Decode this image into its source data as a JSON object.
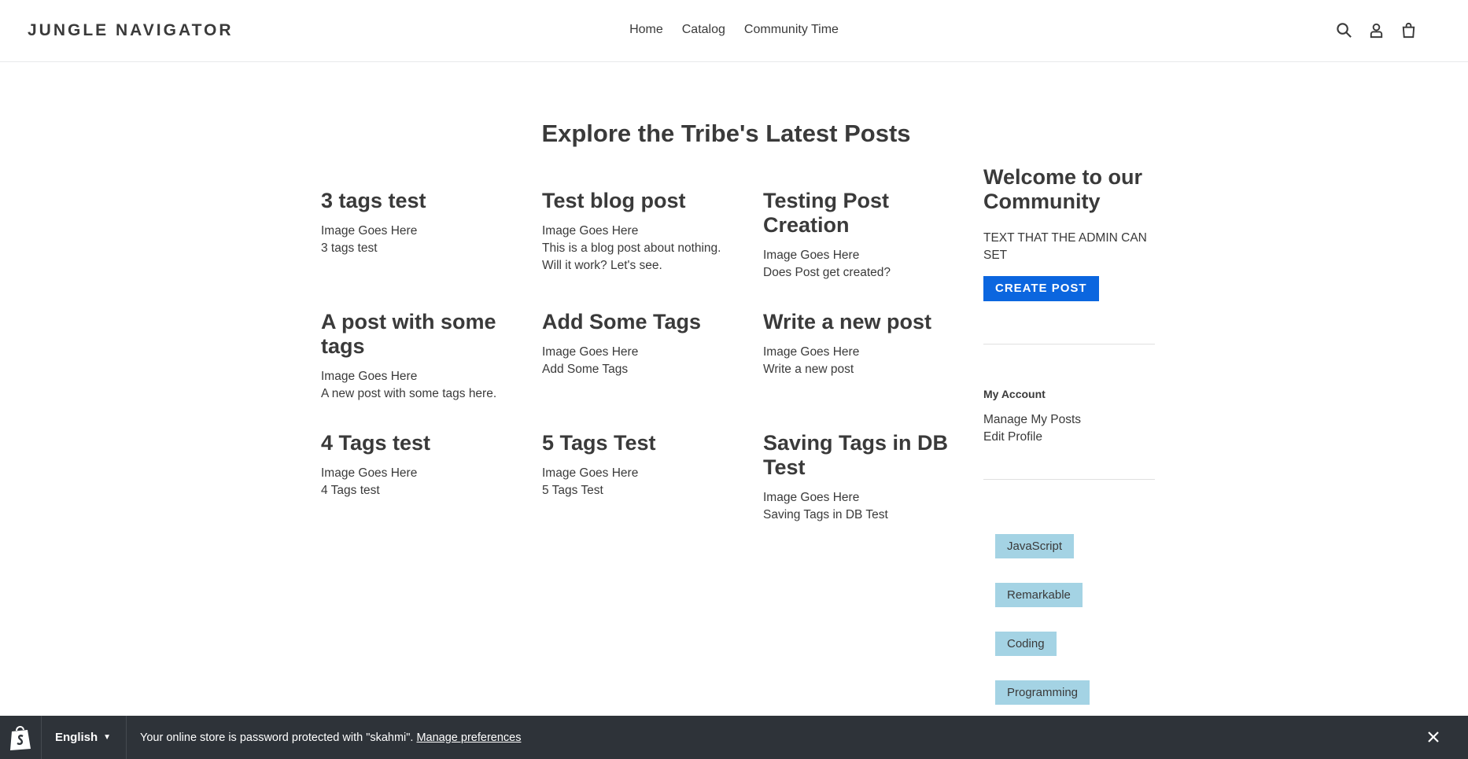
{
  "header": {
    "logo": "JUNGLE NAVIGATOR",
    "nav": [
      "Home",
      "Catalog",
      "Community Time"
    ]
  },
  "page_title": "Explore the Tribe's Latest Posts",
  "posts": [
    {
      "title": "3 tags test",
      "image": "Image Goes Here",
      "excerpt": "3 tags test"
    },
    {
      "title": "Test blog post",
      "image": "Image Goes Here",
      "excerpt": "This is a blog post about nothing. Will it work? Let's see."
    },
    {
      "title": "Testing Post Creation",
      "image": "Image Goes Here",
      "excerpt": "Does Post get created?"
    },
    {
      "title": "A post with some tags",
      "image": "Image Goes Here",
      "excerpt": "A new post with some tags here."
    },
    {
      "title": "Add Some Tags",
      "image": "Image Goes Here",
      "excerpt": "Add Some Tags"
    },
    {
      "title": "Write a new post",
      "image": "Image Goes Here",
      "excerpt": "Write a new post"
    },
    {
      "title": "4 Tags test",
      "image": "Image Goes Here",
      "excerpt": "4 Tags test"
    },
    {
      "title": "5 Tags Test",
      "image": "Image Goes Here",
      "excerpt": "5 Tags Test"
    },
    {
      "title": "Saving Tags in DB Test",
      "image": "Image Goes Here",
      "excerpt": "Saving Tags in DB Test"
    }
  ],
  "sidebar": {
    "title": "Welcome to our Community",
    "text": "TEXT THAT THE ADMIN CAN SET",
    "create_button": "CREATE POST",
    "account_heading": "My Account",
    "account_links": [
      "Manage My Posts",
      "Edit Profile"
    ],
    "tags": [
      "JavaScript",
      "Remarkable",
      "Coding",
      "Programming"
    ]
  },
  "bottom_bar": {
    "language": "English",
    "notice": "Your online store is password protected with \"skahmi\".",
    "link": "Manage preferences"
  },
  "colors": {
    "accent": "#0b66df",
    "tag_bg": "#a4d3e4",
    "bar_bg": "#2e3339"
  }
}
